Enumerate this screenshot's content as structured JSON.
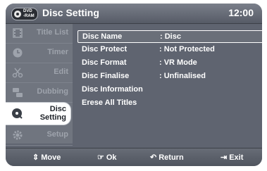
{
  "header": {
    "badge_top": "DVD",
    "badge_bottom": "-RAM",
    "title": "Disc Setting",
    "clock": "12:00"
  },
  "sidebar": {
    "items": [
      {
        "label": "Title List",
        "icon": "film-icon"
      },
      {
        "label": "Timer",
        "icon": "clock-icon"
      },
      {
        "label": "Edit",
        "icon": "scissors-icon"
      },
      {
        "label": "Dubbing",
        "icon": "dubbing-icon"
      },
      {
        "label": "Disc Setting",
        "icon": "disc-icon",
        "active": true
      },
      {
        "label": "Setup",
        "icon": "gear-icon"
      }
    ]
  },
  "menu": {
    "rows": [
      {
        "key": "Disc Name",
        "value": ": Disc",
        "selected": true
      },
      {
        "key": "Disc Protect",
        "value": ": Not Protected"
      },
      {
        "key": "Disc Format",
        "value": ": VR Mode"
      },
      {
        "key": "Disc Finalise",
        "value": ": Unfinalised"
      },
      {
        "key": "Disc Information",
        "value": ""
      },
      {
        "key": "Erese All Titles",
        "value": ""
      }
    ]
  },
  "footer": {
    "move": "Move",
    "ok": "Ok",
    "return": "Return",
    "exit": "Exit",
    "move_glyph": "⇕",
    "ok_glyph": "☞",
    "return_glyph": "↶",
    "exit_glyph": "⇥"
  },
  "colors": {
    "panel": "#5f6470",
    "sidebar": "#70757f",
    "text": "#ffffff",
    "inactive_text": "#9ea3ac"
  }
}
